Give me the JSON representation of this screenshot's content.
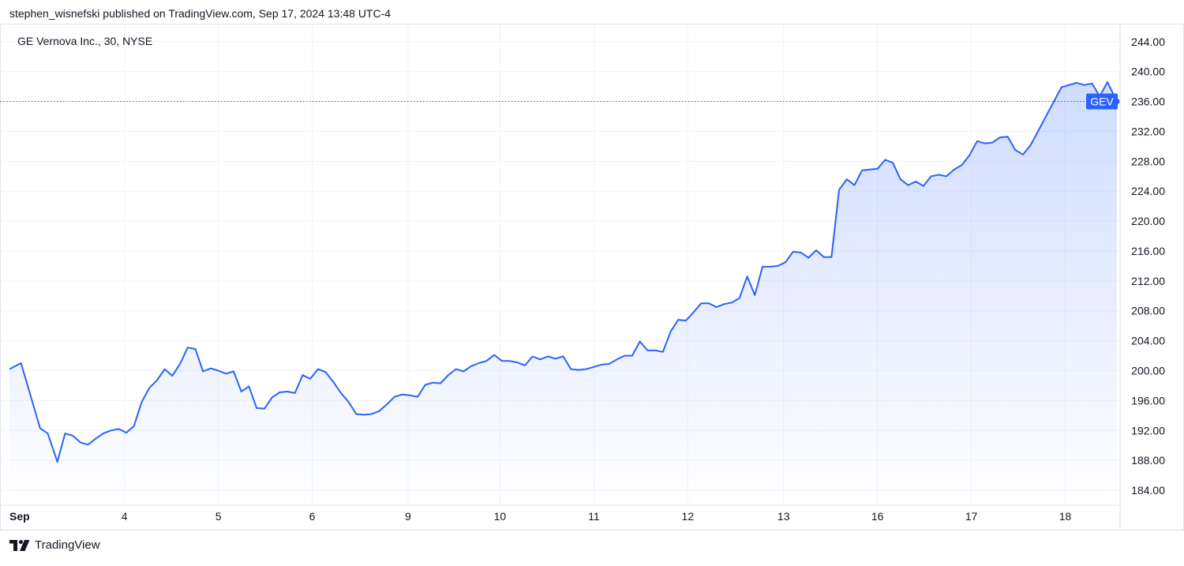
{
  "header": {
    "published": "stephen_wisnefski published on TradingView.com, Sep 17, 2024 13:48 UTC-4"
  },
  "footer": {
    "brand": "TradingView",
    "logo_icon": "tradingview-logo-icon"
  },
  "colors": {
    "line": "#2962ff",
    "grid": "#f0f3fa",
    "label_bg": "#2962ff",
    "text": "#131722"
  },
  "chart_data": {
    "type": "area",
    "title": "GE Vernova Inc., 30, NYSE",
    "series": [
      {
        "name": "GEV",
        "last_value": 236.0,
        "points": [
          [
            0,
            200.2
          ],
          [
            0.3,
            201.0
          ],
          [
            0.8,
            192.3
          ],
          [
            1.0,
            191.6
          ],
          [
            1.25,
            187.8
          ],
          [
            1.45,
            191.6
          ],
          [
            1.65,
            191.3
          ],
          [
            1.85,
            190.4
          ],
          [
            2.05,
            190.1
          ],
          [
            2.25,
            190.9
          ],
          [
            2.45,
            191.6
          ],
          [
            2.65,
            192.0
          ],
          [
            2.85,
            192.2
          ],
          [
            3.05,
            191.7
          ],
          [
            3.25,
            192.6
          ],
          [
            3.45,
            195.8
          ],
          [
            3.65,
            197.7
          ],
          [
            3.85,
            198.7
          ],
          [
            4.05,
            200.2
          ],
          [
            4.25,
            199.3
          ],
          [
            4.45,
            200.9
          ],
          [
            4.65,
            203.1
          ],
          [
            4.85,
            202.9
          ],
          [
            5.05,
            199.9
          ],
          [
            5.25,
            200.3
          ],
          [
            5.45,
            200.0
          ],
          [
            5.65,
            199.6
          ],
          [
            5.85,
            199.9
          ],
          [
            6.05,
            197.2
          ],
          [
            6.25,
            197.9
          ],
          [
            6.45,
            195.0
          ],
          [
            6.65,
            194.9
          ],
          [
            6.85,
            196.4
          ],
          [
            7.05,
            197.1
          ],
          [
            7.25,
            197.2
          ],
          [
            7.45,
            197.0
          ],
          [
            7.65,
            199.4
          ],
          [
            7.85,
            198.9
          ],
          [
            8.05,
            200.2
          ],
          [
            8.25,
            199.8
          ],
          [
            8.45,
            198.5
          ],
          [
            8.65,
            197.0
          ],
          [
            8.85,
            195.8
          ],
          [
            9.05,
            194.2
          ],
          [
            9.25,
            194.1
          ],
          [
            9.45,
            194.2
          ],
          [
            9.65,
            194.6
          ],
          [
            9.85,
            195.5
          ],
          [
            10.05,
            196.5
          ],
          [
            10.25,
            196.8
          ],
          [
            10.45,
            196.7
          ],
          [
            10.65,
            196.5
          ],
          [
            10.85,
            198.1
          ],
          [
            11.05,
            198.4
          ],
          [
            11.25,
            198.3
          ],
          [
            11.45,
            199.4
          ],
          [
            11.65,
            200.2
          ],
          [
            11.85,
            199.9
          ],
          [
            12.05,
            200.6
          ],
          [
            12.25,
            201.0
          ],
          [
            12.45,
            201.3
          ],
          [
            12.65,
            202.1
          ],
          [
            12.85,
            201.3
          ],
          [
            13.05,
            201.3
          ],
          [
            13.25,
            201.1
          ],
          [
            13.45,
            200.7
          ],
          [
            13.65,
            201.9
          ],
          [
            13.85,
            201.5
          ],
          [
            14.05,
            201.9
          ],
          [
            14.25,
            201.6
          ],
          [
            14.45,
            201.9
          ],
          [
            14.65,
            200.2
          ],
          [
            14.85,
            200.1
          ],
          [
            15.05,
            200.2
          ],
          [
            15.25,
            200.5
          ],
          [
            15.45,
            200.8
          ],
          [
            15.65,
            200.9
          ],
          [
            15.85,
            201.5
          ],
          [
            16.05,
            202.0
          ],
          [
            16.25,
            202.0
          ],
          [
            16.45,
            203.9
          ],
          [
            16.65,
            202.7
          ],
          [
            16.85,
            202.7
          ],
          [
            17.05,
            202.5
          ],
          [
            17.25,
            205.2
          ],
          [
            17.45,
            206.8
          ],
          [
            17.65,
            206.7
          ],
          [
            17.85,
            207.8
          ],
          [
            18.05,
            209.0
          ],
          [
            18.25,
            209.0
          ],
          [
            18.45,
            208.5
          ],
          [
            18.65,
            208.9
          ],
          [
            18.85,
            209.1
          ],
          [
            19.05,
            209.7
          ],
          [
            19.25,
            212.6
          ],
          [
            19.45,
            210.1
          ],
          [
            19.65,
            213.9
          ],
          [
            19.85,
            213.9
          ],
          [
            20.05,
            214.0
          ],
          [
            20.25,
            214.5
          ],
          [
            20.45,
            215.9
          ],
          [
            20.65,
            215.8
          ],
          [
            20.85,
            215.1
          ],
          [
            21.05,
            216.1
          ],
          [
            21.25,
            215.2
          ],
          [
            21.45,
            215.2
          ],
          [
            21.65,
            224.2
          ],
          [
            21.85,
            225.6
          ],
          [
            22.05,
            224.8
          ],
          [
            22.25,
            226.8
          ],
          [
            22.45,
            226.9
          ],
          [
            22.65,
            227.0
          ],
          [
            22.85,
            228.2
          ],
          [
            23.05,
            227.8
          ],
          [
            23.25,
            225.6
          ],
          [
            23.45,
            224.8
          ],
          [
            23.65,
            225.3
          ],
          [
            23.85,
            224.7
          ],
          [
            24.05,
            226.0
          ],
          [
            24.25,
            226.2
          ],
          [
            24.45,
            226.0
          ],
          [
            24.65,
            226.9
          ],
          [
            24.85,
            227.5
          ],
          [
            25.05,
            228.8
          ],
          [
            25.25,
            230.7
          ],
          [
            25.45,
            230.4
          ],
          [
            25.65,
            230.5
          ],
          [
            25.85,
            231.2
          ],
          [
            26.05,
            231.3
          ],
          [
            26.25,
            229.5
          ],
          [
            26.45,
            228.9
          ],
          [
            26.65,
            230.2
          ],
          [
            27.45,
            237.9
          ],
          [
            27.65,
            238.2
          ],
          [
            27.85,
            238.5
          ],
          [
            28.05,
            238.2
          ],
          [
            28.25,
            238.4
          ],
          [
            28.45,
            236.7
          ],
          [
            28.65,
            238.6
          ],
          [
            28.9,
            236.0
          ]
        ]
      }
    ],
    "x_ticks": [
      {
        "pos": 0.6,
        "label": "Sep"
      },
      {
        "pos": 3.0,
        "label": "4"
      },
      {
        "pos": 5.45,
        "label": "5"
      },
      {
        "pos": 7.9,
        "label": "6"
      },
      {
        "pos": 10.4,
        "label": "9"
      },
      {
        "pos": 12.8,
        "label": "10"
      },
      {
        "pos": 15.25,
        "label": "11"
      },
      {
        "pos": 17.7,
        "label": "12"
      },
      {
        "pos": 20.2,
        "label": "13"
      },
      {
        "pos": 22.65,
        "label": "16"
      },
      {
        "pos": 25.1,
        "label": "17"
      },
      {
        "pos": 27.55,
        "label": "18"
      }
    ],
    "x_range": [
      0,
      29.0
    ],
    "y_ticks": [
      "244.00",
      "240.00",
      "236.00",
      "232.00",
      "228.00",
      "224.00",
      "220.00",
      "216.00",
      "212.00",
      "208.00",
      "204.00",
      "200.00",
      "196.00",
      "192.00",
      "188.00",
      "184.00"
    ],
    "y_range": [
      182.0,
      246.3
    ],
    "grid": true,
    "legend": "top-left",
    "price_label": "GEV"
  }
}
